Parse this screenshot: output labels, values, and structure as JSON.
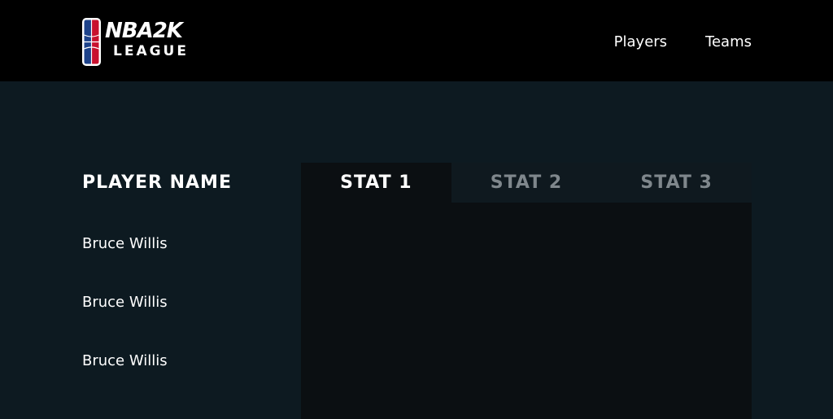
{
  "header": {
    "logo": {
      "line1": "NBA2K",
      "line2": "LEAGUE",
      "badge_colors": [
        "#1d428a",
        "#c8102e"
      ]
    },
    "nav": [
      {
        "label": "Players"
      },
      {
        "label": "Teams"
      }
    ]
  },
  "table": {
    "name_header": "PLAYER NAME",
    "stat_tabs": [
      {
        "label": "STAT 1",
        "active": true
      },
      {
        "label": "STAT 2",
        "active": false
      },
      {
        "label": "STAT 3",
        "active": false
      }
    ],
    "players": [
      {
        "name": "Bruce Willis"
      },
      {
        "name": "Bruce Willis"
      },
      {
        "name": "Bruce Willis"
      }
    ]
  },
  "colors": {
    "header_bg": "#000000",
    "page_bg": "#0d1a21",
    "panel_bg": "#0b0f12",
    "inactive_tab_text": "#7f878c"
  }
}
